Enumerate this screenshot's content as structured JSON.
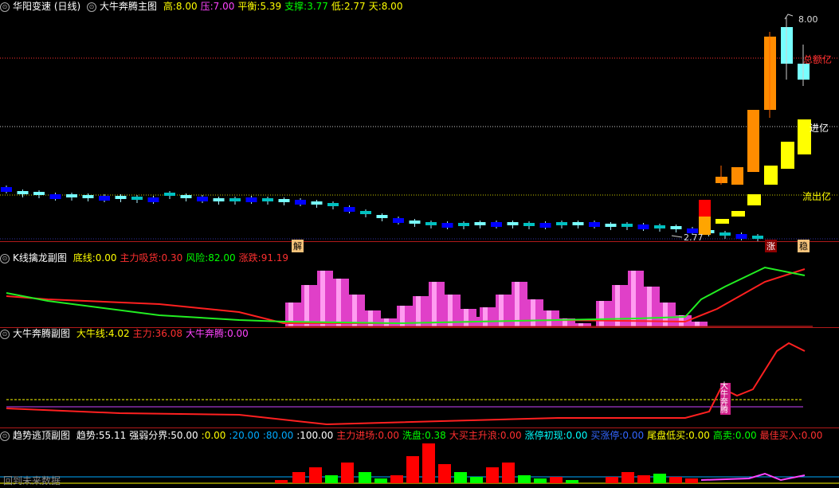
{
  "main": {
    "circle_glyph": "⊙",
    "title": "华阳变速 (日线)",
    "indicator": "大牛奔腾主图",
    "params": [
      {
        "label": "高:",
        "value": "8.00",
        "color": "#ffff00"
      },
      {
        "label": "压:",
        "value": "7.00",
        "color": "#ff44ff"
      },
      {
        "label": "平衡:",
        "value": "5.39",
        "color": "#ffff00"
      },
      {
        "label": "支撑:",
        "value": "3.77",
        "color": "#00ff00"
      },
      {
        "label": "低:",
        "value": "2.77",
        "color": "#ffff00"
      },
      {
        "label": "天:",
        "value": "8.00",
        "color": "#ffff00"
      }
    ],
    "price_high_label": "8.00",
    "price_low_label": "2.77",
    "line_labels": [
      {
        "text": "总额亿",
        "color": "#ff3030"
      },
      {
        "text": "进亿",
        "color": "#ffffff"
      },
      {
        "text": "流出亿",
        "color": "#ffff00"
      }
    ],
    "marker_jie": "解",
    "marker_zhang": "涨",
    "marker_ji": "稳"
  },
  "sub1": {
    "indicator": "K线擒龙副图",
    "params": [
      {
        "label": "底线:",
        "value": "0.00",
        "color": "#ffff00"
      },
      {
        "label": "主力吸货:",
        "value": "0.30",
        "color": "#ff3030"
      },
      {
        "label": "风险:",
        "value": "82.00",
        "color": "#00ff00"
      },
      {
        "label": "涨跌:",
        "value": "91.19",
        "color": "#ff3030"
      }
    ]
  },
  "sub2": {
    "indicator": "大牛奔腾副图",
    "params": [
      {
        "label": "大牛线:",
        "value": "4.02",
        "color": "#ffff00"
      },
      {
        "label": "主力:",
        "value": "36.08",
        "color": "#ff3030"
      },
      {
        "label": "大牛奔腾:",
        "value": "0.00",
        "color": "#ff44ff"
      }
    ],
    "marker_text": "大牛奔腾"
  },
  "sub3": {
    "indicator": "趋势逃顶副图",
    "params": [
      {
        "label": "趋势:",
        "value": "55.11",
        "color": "#ffffff"
      },
      {
        "label": "强弱分界:",
        "value": "50.00",
        "color": "#ffffff"
      },
      {
        "label": ":",
        "value": "0.00",
        "color": "#ffff00"
      },
      {
        "label": ":",
        "value": "20.00",
        "color": "#00aaff"
      },
      {
        "label": ":",
        "value": "80.00",
        "color": "#00aaff"
      },
      {
        "label": ":",
        "value": "100.00",
        "color": "#ffffff"
      },
      {
        "label": "主力进场:",
        "value": "0.00",
        "color": "#ff3030"
      },
      {
        "label": "洗盘:",
        "value": "0.38",
        "color": "#00ff00"
      },
      {
        "label": "大买主升浪:",
        "value": "0.00",
        "color": "#ff3030"
      },
      {
        "label": "涨停初现:",
        "value": "0.00",
        "color": "#00ffff"
      },
      {
        "label": "买涨停:",
        "value": "0.00",
        "color": "#3366ff"
      },
      {
        "label": "尾盘低买:",
        "value": "0.00",
        "color": "#ffff00"
      },
      {
        "label": "高卖:",
        "value": "0.00",
        "color": "#00ff00"
      },
      {
        "label": "最佳买入:",
        "value": "0.00",
        "color": "#ff3030"
      }
    ],
    "bottom_text": "回到未来数据"
  }
}
